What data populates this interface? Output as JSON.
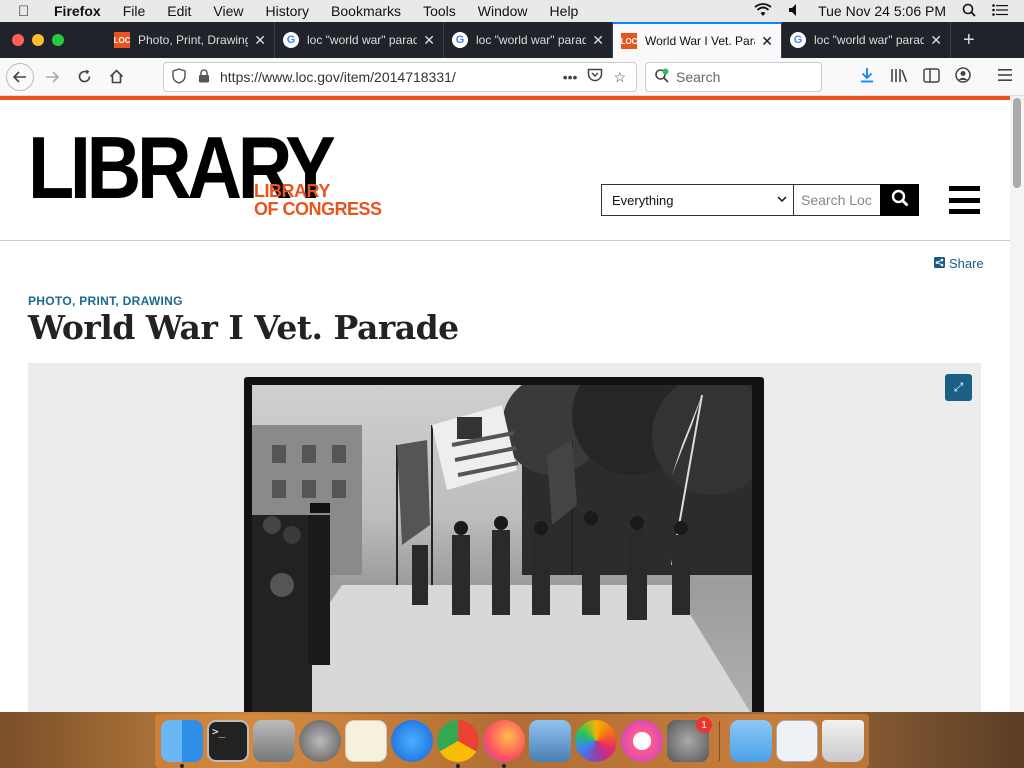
{
  "menubar": {
    "app": "Firefox",
    "items": [
      "File",
      "Edit",
      "View",
      "History",
      "Bookmarks",
      "Tools",
      "Window",
      "Help"
    ],
    "datetime": "Tue Nov 24  5:06 PM"
  },
  "tabs": [
    {
      "title": "Photo, Print, Drawing",
      "favicon": "LOC"
    },
    {
      "title": "loc \"world war\" parade",
      "favicon": "G"
    },
    {
      "title": "loc \"world war\" parade",
      "favicon": "G"
    },
    {
      "title": "World War I Vet. Parade",
      "favicon": "LOC"
    },
    {
      "title": "loc \"world war\" parade",
      "favicon": "G"
    }
  ],
  "navbar": {
    "url": "https://www.loc.gov/item/2014718331/",
    "search_placeholder": "Search"
  },
  "site": {
    "logo_big": "LIBRARY",
    "logo_line1": "LIBRARY",
    "logo_line2": "OF CONGRESS",
    "search_scope": "Everything",
    "search_placeholder": "Search Loc",
    "share": "Share",
    "eyebrow": "PHOTO, PRINT, DRAWING",
    "title": "World War I Vet. Parade"
  },
  "colors": {
    "loc_orange": "#e9531e",
    "loc_blue": "#1a5f86",
    "firefox_accent": "#0a84ff"
  },
  "dock": [
    "finder",
    "terminal",
    "calculator",
    "launchpad",
    "textedit",
    "safari",
    "chrome",
    "firefox",
    "preview",
    "photos",
    "itunes",
    "system-preferences",
    "downloads",
    "screenshot",
    "trash"
  ],
  "dock_badge": "1"
}
